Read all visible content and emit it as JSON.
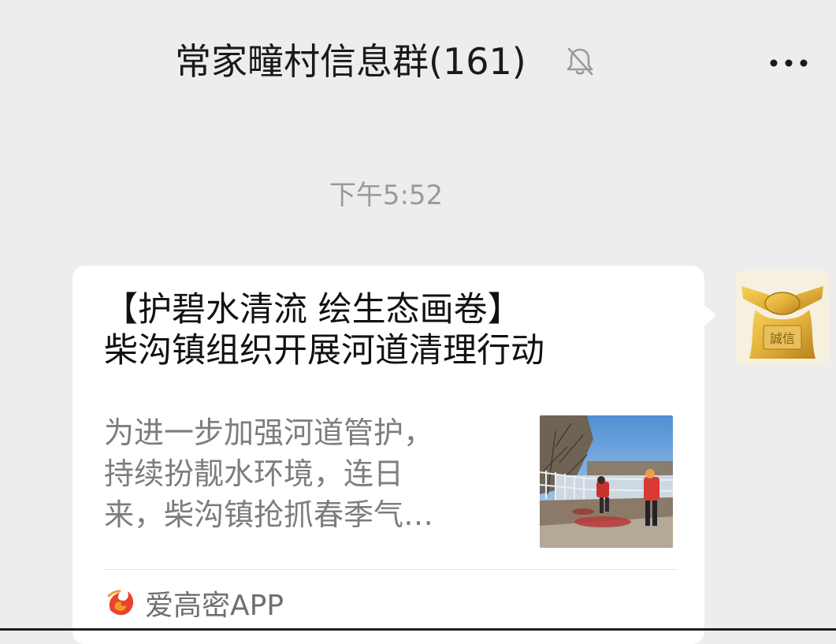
{
  "header": {
    "title": "常家疃村信息群(161)",
    "mute_icon": "bell-off-icon",
    "more_icon": "more-dots-icon"
  },
  "timestamp": "下午5:52",
  "message": {
    "title_line1": "【护碧水清流 绘生态画卷】",
    "title_line2": "柴沟镇组织开展河道清理行动",
    "summary_line1": "为进一步加强河道管护，",
    "summary_line2": "持续扮靓水环境，连日",
    "summary_line3": "来，柴沟镇抢抓春季气…",
    "thumbnail": "river-cleanup-photo",
    "source_name": "爱高密APP",
    "source_logo": "flame-logo-icon"
  },
  "sender": {
    "avatar_text": "誠信",
    "avatar_icon": "golden-handshake-avatar"
  },
  "colors": {
    "background": "#ededed",
    "bubble": "#ffffff",
    "title_text": "#111111",
    "summary_text": "#7d7d7d",
    "timestamp_text": "#9a9a9a",
    "source_logo_red": "#e8432f",
    "source_logo_orange": "#f29b2a",
    "avatar_gold": "#e2b13a"
  }
}
